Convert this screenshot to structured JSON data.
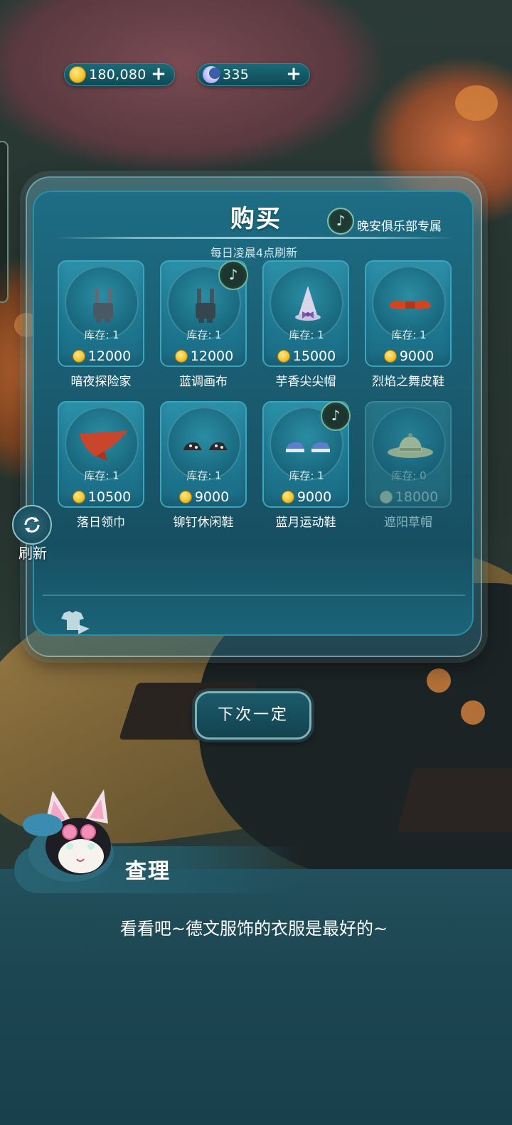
{
  "currency": {
    "gold": {
      "value": "180,080",
      "icon": "coin-icon"
    },
    "moon": {
      "value": "335",
      "icon": "moon-icon"
    },
    "plus_label": "+"
  },
  "shop": {
    "title": "购买",
    "club_label": "晚安俱乐部专属",
    "refresh_note": "每日凌晨4点刷新",
    "stock_prefix": "库存: ",
    "items": [
      {
        "name": "暗夜探险家",
        "stock": "1",
        "price": "12000",
        "art": "overalls-dark",
        "club": false,
        "soldout": false
      },
      {
        "name": "蓝调画布",
        "stock": "1",
        "price": "12000",
        "art": "overalls-blue",
        "club": true,
        "soldout": false
      },
      {
        "name": "芋香尖尖帽",
        "stock": "1",
        "price": "15000",
        "art": "pointy-hat",
        "club": false,
        "soldout": false
      },
      {
        "name": "烈焰之舞皮鞋",
        "stock": "1",
        "price": "9000",
        "art": "red-shoes",
        "club": false,
        "soldout": false
      },
      {
        "name": "落日领巾",
        "stock": "1",
        "price": "10500",
        "art": "red-scarf",
        "club": false,
        "soldout": false
      },
      {
        "name": "铆钉休闲鞋",
        "stock": "1",
        "price": "9000",
        "art": "studded-shoes",
        "club": false,
        "soldout": false
      },
      {
        "name": "蓝月运动鞋",
        "stock": "1",
        "price": "9000",
        "art": "blue-sneakers",
        "club": true,
        "soldout": false
      },
      {
        "name": "遮阳草帽",
        "stock": "0",
        "price": "18000",
        "art": "straw-hat",
        "club": false,
        "soldout": true
      }
    ]
  },
  "refresh_label": "刷新",
  "next_button": "下次一定",
  "dialog": {
    "speaker": "查理",
    "text": "看看吧~德文服饰的衣服是最好的~"
  },
  "colors": {
    "panel": "#1d6d84",
    "card": "#2b90a8",
    "accent": "#7fc2a8"
  }
}
